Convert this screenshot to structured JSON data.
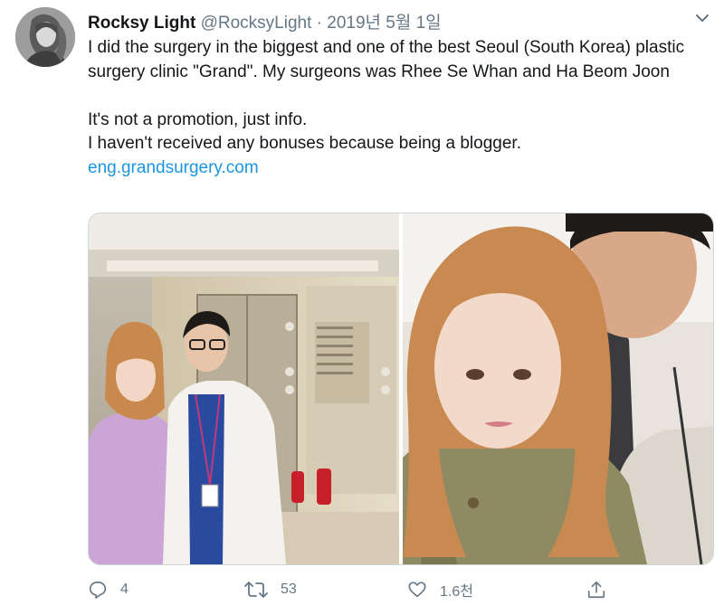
{
  "tweet": {
    "display_name": "Rocksy Light",
    "handle": "@RocksyLight",
    "separator": "·",
    "date": "2019년 5월 1일",
    "text_line1": "I did the surgery in the biggest and one of the best Seoul (South Korea) plastic surgery clinic \"Grand\". My surgeons was Rhee Se Whan and Ha Beom Joon",
    "text_line2": "It's not a promotion, just info.",
    "text_line3": "I haven't received any bonuses because being a blogger.",
    "link": "eng.grandsurgery.com"
  },
  "actions": {
    "reply_count": "4",
    "retweet_count": "53",
    "like_count": "1.6천"
  },
  "icons": {
    "menu": "chevron-down-icon",
    "reply": "reply-icon",
    "retweet": "retweet-icon",
    "like": "heart-icon",
    "share": "share-icon"
  },
  "colors": {
    "text": "#14171a",
    "muted": "#657786",
    "link": "#1b95e0"
  }
}
